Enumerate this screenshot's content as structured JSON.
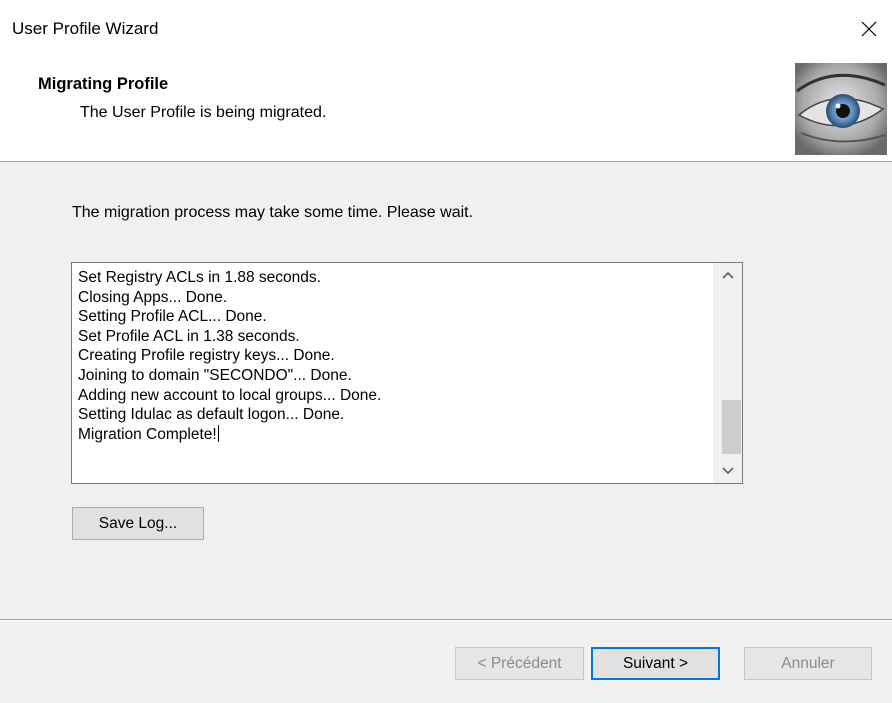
{
  "window": {
    "title": "User Profile Wizard",
    "close_icon": "close-icon"
  },
  "header": {
    "title": "Migrating Profile",
    "subtitle": "The User Profile is being migrated.",
    "image_icon": "eye-icon"
  },
  "main": {
    "instruction": "The migration process may take some time. Please wait.",
    "log_lines": [
      "Set Registry ACLs in 1.88 seconds.",
      "Closing Apps... Done.",
      "Setting Profile ACL... Done.",
      "Set Profile ACL in 1.38 seconds.",
      "Creating Profile registry keys... Done.",
      "Joining to domain \"SECONDO\"... Done.",
      "Adding new account to local groups... Done.",
      "Setting Idulac as default logon... Done.",
      "Migration Complete!"
    ],
    "save_log_label": "Save Log..."
  },
  "footer": {
    "back_label": "< Précédent",
    "next_label": "Suivant >",
    "cancel_label": "Annuler"
  },
  "colors": {
    "accent": "#0078d7",
    "disabled_text": "#8c8c8c",
    "dialog_bg": "#f0f0f0"
  }
}
